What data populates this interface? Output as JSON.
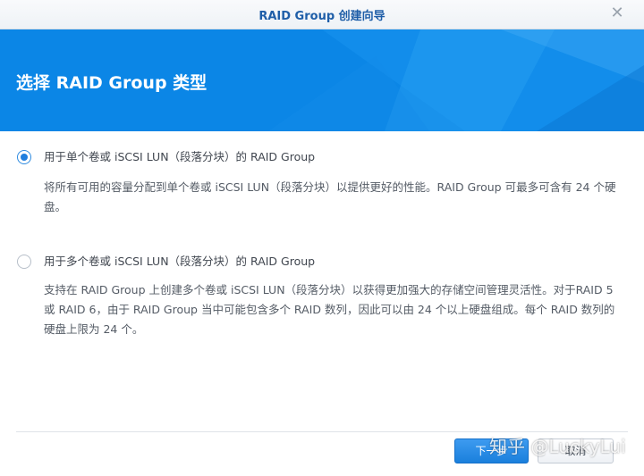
{
  "window": {
    "title": "RAID Group 创建向导",
    "close_icon": "close-icon"
  },
  "banner": {
    "heading": "选择 RAID Group 类型",
    "color": "#0b86e6"
  },
  "options": [
    {
      "label": "用于单个卷或 iSCSI LUN（段落分块）的 RAID Group",
      "selected": true,
      "description": "将所有可用的容量分配到单个卷或 iSCSI LUN（段落分块）以提供更好的性能。RAID Group 可最多可含有 24 个硬盘。"
    },
    {
      "label": "用于多个卷或 iSCSI LUN（段落分块）的 RAID Group",
      "selected": false,
      "description": "支持在 RAID Group 上创建多个卷或 iSCSI LUN（段落分块）以获得更加强大的存储空间管理灵活性。对于RAID 5 或 RAID 6，由于 RAID Group 当中可能包含多个 RAID 数列，因此可以由 24 个以上硬盘组成。每个 RAID 数列的硬盘上限为 24 个。"
    }
  ],
  "footer": {
    "next_label": "下一步",
    "cancel_label": "取消"
  },
  "watermark": "知乎 @LuckyLui",
  "colors": {
    "accent": "#1f7ede",
    "title_text": "#1f5ea8"
  }
}
